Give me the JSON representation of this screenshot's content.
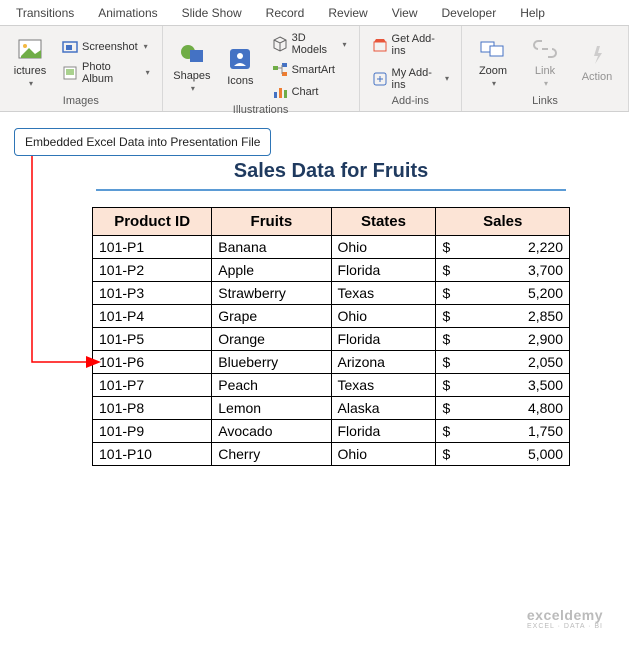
{
  "tabs": [
    "Transitions",
    "Animations",
    "Slide Show",
    "Record",
    "Review",
    "View",
    "Developer",
    "Help"
  ],
  "ribbon": {
    "images": {
      "label": "Images",
      "pictures": "ictures",
      "screenshot": "Screenshot",
      "photo_album": "Photo Album"
    },
    "illustrations": {
      "label": "Illustrations",
      "shapes": "Shapes",
      "icons": "Icons",
      "models": "3D Models",
      "smartart": "SmartArt",
      "chart": "Chart"
    },
    "addins": {
      "label": "Add-ins",
      "get": "Get Add-ins",
      "my": "My Add-ins"
    },
    "links": {
      "label": "Links",
      "zoom": "Zoom",
      "link": "Link",
      "action": "Action"
    }
  },
  "callout": "Embedded Excel Data into Presentation File",
  "chart_data": {
    "type": "table",
    "title": "Sales Data for Fruits",
    "columns": [
      "Product ID",
      "Fruits",
      "States",
      "Sales"
    ],
    "rows": [
      {
        "id": "101-P1",
        "fruit": "Banana",
        "state": "Ohio",
        "sales": 2220
      },
      {
        "id": "101-P2",
        "fruit": "Apple",
        "state": "Florida",
        "sales": 3700
      },
      {
        "id": "101-P3",
        "fruit": "Strawberry",
        "state": "Texas",
        "sales": 5200
      },
      {
        "id": "101-P4",
        "fruit": "Grape",
        "state": "Ohio",
        "sales": 2850
      },
      {
        "id": "101-P5",
        "fruit": "Orange",
        "state": "Florida",
        "sales": 2900
      },
      {
        "id": "101-P6",
        "fruit": "Blueberry",
        "state": "Arizona",
        "sales": 2050
      },
      {
        "id": "101-P7",
        "fruit": "Peach",
        "state": "Texas",
        "sales": 3500
      },
      {
        "id": "101-P8",
        "fruit": "Lemon",
        "state": "Alaska",
        "sales": 4800
      },
      {
        "id": "101-P9",
        "fruit": "Avocado",
        "state": "Florida",
        "sales": 1750
      },
      {
        "id": "101-P10",
        "fruit": "Cherry",
        "state": "Ohio",
        "sales": 5000
      }
    ]
  },
  "watermark": {
    "main": "exceldemy",
    "sub": "EXCEL · DATA · BI"
  }
}
